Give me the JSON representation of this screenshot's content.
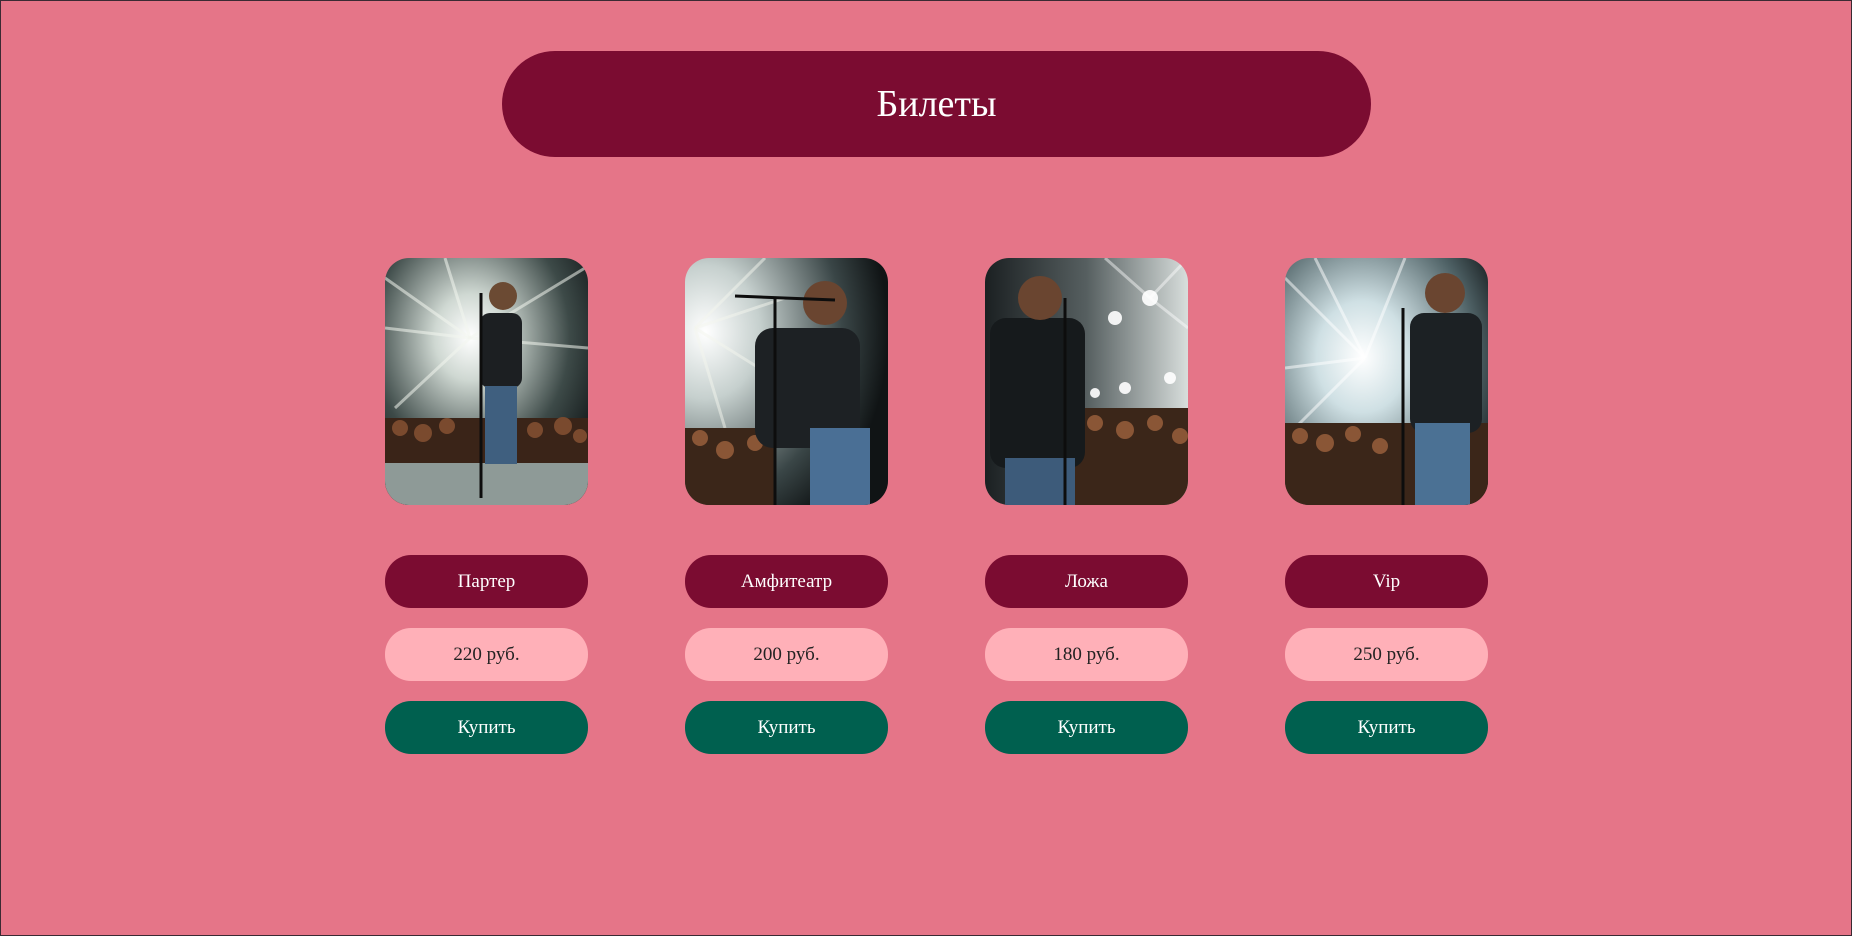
{
  "page": {
    "title": "Билеты",
    "colors": {
      "background": "#e57588",
      "header": "#7b0c31",
      "name_pill": "#7b0c31",
      "price_pill": "#ffb0b8",
      "buy_button": "#00604f"
    }
  },
  "tickets": [
    {
      "name": "Партер",
      "price": "220 руб.",
      "buy_label": "Купить",
      "image": "singer-on-stage-photo"
    },
    {
      "name": "Амфитеатр",
      "price": "200 руб.",
      "buy_label": "Купить",
      "image": "singer-with-crowd-photo"
    },
    {
      "name": "Ложа",
      "price": "180 руб.",
      "buy_label": "Купить",
      "image": "singer-spotlights-photo"
    },
    {
      "name": "Vip",
      "price": "250 руб.",
      "buy_label": "Купить",
      "image": "singer-bright-lights-photo"
    }
  ]
}
